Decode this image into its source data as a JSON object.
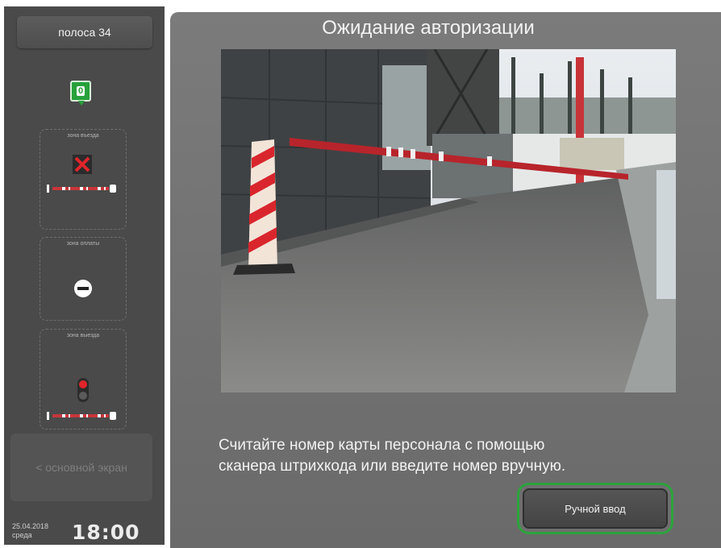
{
  "sidebar": {
    "lane_label": "полоса 34",
    "counter": "0",
    "zones": [
      {
        "label": "зона въезда",
        "status": "closed-x"
      },
      {
        "label": "зона оплаты",
        "status": "no-entry"
      },
      {
        "label": "зона выезда",
        "status": "red-light"
      }
    ],
    "back_label": "< основной экран",
    "date": "25.04.2018",
    "weekday": "среда",
    "time": "18:00"
  },
  "main": {
    "title": "Ожидание авторизации",
    "camera": "barrier-camera-view",
    "instruction_line1": "Считайте номер карты персонала с помощью",
    "instruction_line2": "сканера штрихкода или введите номер вручную.",
    "manual_button": "Ручной ввод"
  },
  "colors": {
    "accent_green": "#2ca33c",
    "alert_red": "#e0252b",
    "panel_bg": "#4a4a4a",
    "main_bg": "#737373"
  }
}
